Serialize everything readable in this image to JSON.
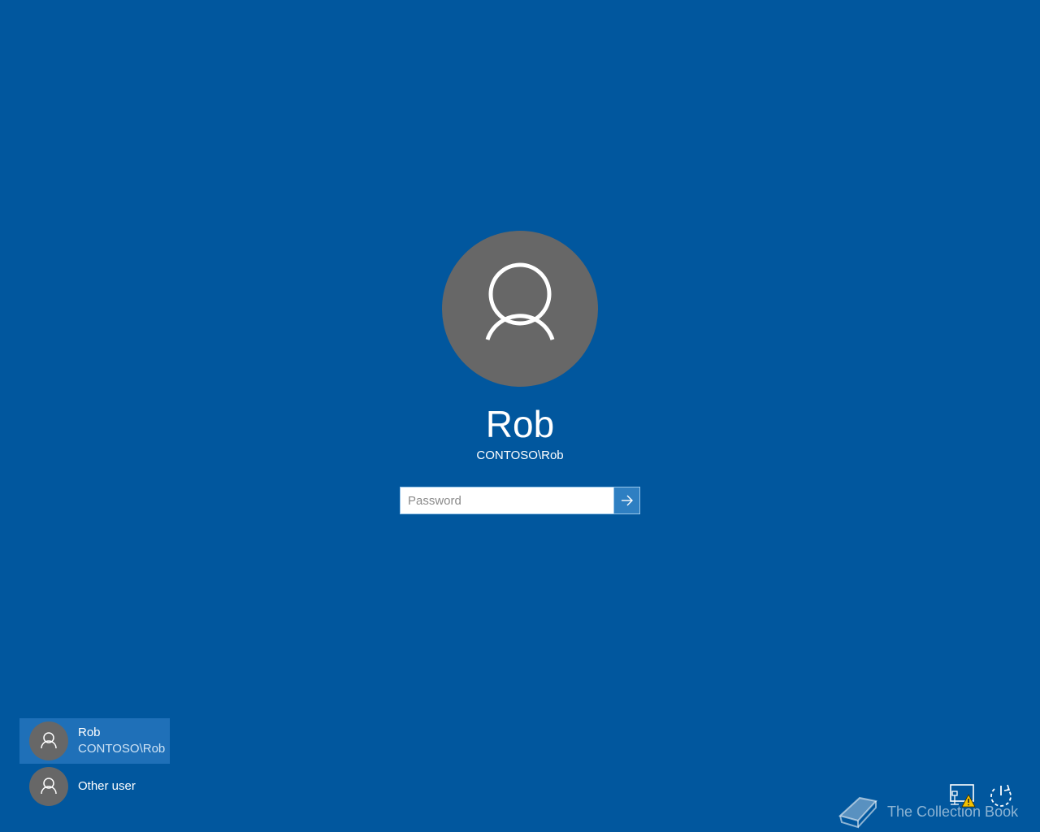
{
  "colors": {
    "background": "#01579e",
    "avatar": "#676767",
    "selected_tile": "#1f70b8",
    "submit_button": "#2e7fc2",
    "warning": "#f4c100"
  },
  "signin": {
    "user_name": "Rob",
    "user_domain": "CONTOSO\\Rob",
    "password_placeholder": "Password",
    "password_value": "",
    "submit_icon": "arrow-right-icon",
    "avatar_icon": "user-silhouette-icon"
  },
  "user_list": [
    {
      "name": "Rob",
      "subtitle": "CONTOSO\\Rob",
      "selected": true,
      "icon": "user-silhouette-icon"
    },
    {
      "name": "Other user",
      "subtitle": "",
      "selected": false,
      "icon": "user-silhouette-icon"
    }
  ],
  "system_icons": {
    "network": "network-warning-icon",
    "power": "power-icon"
  },
  "watermark": {
    "text": "The Collection Book",
    "icon": "book-icon"
  }
}
